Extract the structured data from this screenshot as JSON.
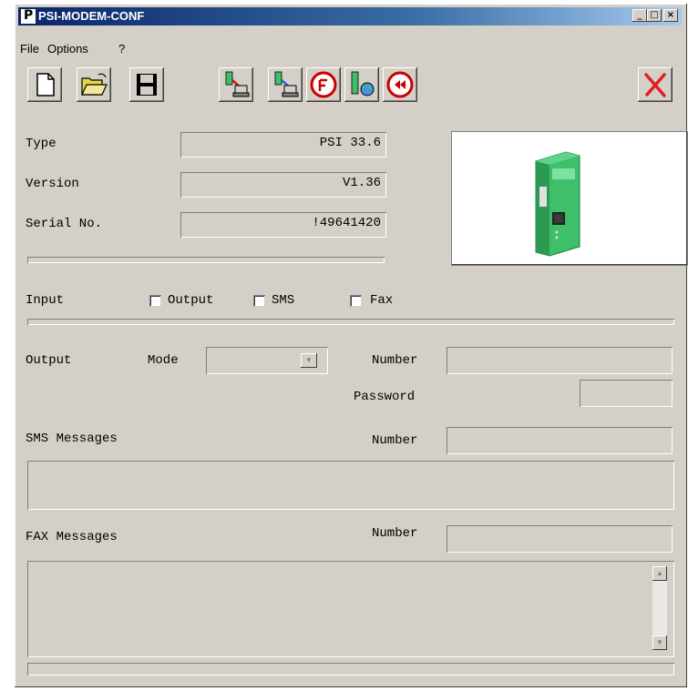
{
  "window": {
    "title": "PSI-MODEM-CONF",
    "controls": {
      "minimize": "_",
      "maximize": "□",
      "close": "×"
    }
  },
  "menu": {
    "items": [
      {
        "label": "File"
      },
      {
        "label": "Options"
      },
      {
        "label": "?"
      }
    ]
  },
  "toolbar": {
    "buttons": [
      {
        "icon": "new-file-icon"
      },
      {
        "icon": "open-folder-icon"
      },
      {
        "icon": "save-disk-icon"
      },
      {
        "icon": "read-from-device-icon"
      },
      {
        "icon": "write-to-device-icon"
      },
      {
        "icon": "reset-icon"
      },
      {
        "icon": "network-test-icon"
      },
      {
        "icon": "rewind-icon"
      },
      {
        "icon": "exit-icon"
      }
    ]
  },
  "device": {
    "type_label": "Type",
    "type_value": "PSI 33.6",
    "version_label": "Version",
    "version_value": "V1.36",
    "serial_label": "Serial No.",
    "serial_value": "!49641420"
  },
  "input": {
    "label": "Input",
    "options": [
      {
        "label": "Output",
        "checked": false
      },
      {
        "label": "SMS",
        "checked": false
      },
      {
        "label": "Fax",
        "checked": false
      }
    ]
  },
  "output": {
    "label": "Output",
    "mode_label": "Mode",
    "mode_value": "",
    "number_label": "Number",
    "number_value": "",
    "password_label": "Password",
    "password_value": ""
  },
  "sms": {
    "label": "SMS Messages",
    "number_label": "Number",
    "number_value": "",
    "message": ""
  },
  "fax": {
    "label": "FAX Messages",
    "number_label": "Number",
    "number_value": "",
    "message": ""
  },
  "colors": {
    "title_start": "#0a246a",
    "title_end": "#a6caf0",
    "face": "#d4d0c8",
    "device_green": "#3fbf6a"
  }
}
